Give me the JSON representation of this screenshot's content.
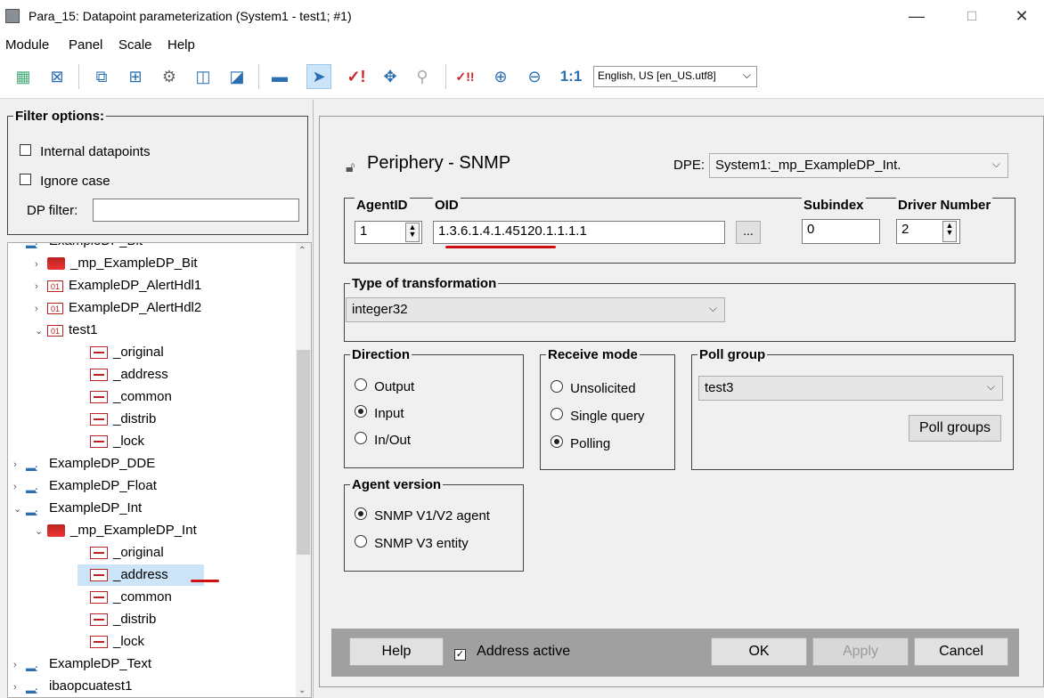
{
  "window": {
    "title": "Para_15: Datapoint parameterization (System1 - test1; #1)",
    "controls": {
      "minimize": "—",
      "maximize": "☐",
      "close": "✕"
    }
  },
  "menu": [
    "Module",
    "Panel",
    "Scale",
    "Help"
  ],
  "toolbar": {
    "zoom_reset": "1:1",
    "language": "English, US [en_US.utf8]"
  },
  "filter": {
    "legend": "Filter options:",
    "internal_datapoints": "Internal datapoints",
    "ignore_case": "Ignore case",
    "dp_filter_label": "DP filter:",
    "dp_filter_value": ""
  },
  "tree": {
    "items": [
      {
        "label": "ExampleDP_Bit",
        "indent": 0,
        "twisty": "",
        "icon": "dp"
      },
      {
        "label": "_mp_ExampleDP_Bit",
        "indent": 1,
        "twisty": "›",
        "icon": "mp"
      },
      {
        "label": "ExampleDP_AlertHdl1",
        "indent": 1,
        "twisty": "›",
        "icon": "01"
      },
      {
        "label": "ExampleDP_AlertHdl2",
        "indent": 1,
        "twisty": "›",
        "icon": "01"
      },
      {
        "label": "test1",
        "indent": 1,
        "twisty": "⌄",
        "icon": "01"
      },
      {
        "label": "_original",
        "indent": 2,
        "twisty": "",
        "icon": "cfg"
      },
      {
        "label": "_address",
        "indent": 2,
        "twisty": "",
        "icon": "cfg"
      },
      {
        "label": "_common",
        "indent": 2,
        "twisty": "",
        "icon": "cfg"
      },
      {
        "label": "_distrib",
        "indent": 2,
        "twisty": "",
        "icon": "cfg"
      },
      {
        "label": "_lock",
        "indent": 2,
        "twisty": "",
        "icon": "cfg"
      },
      {
        "label": "ExampleDP_DDE",
        "indent": 0,
        "twisty": "›",
        "icon": "dp"
      },
      {
        "label": "ExampleDP_Float",
        "indent": 0,
        "twisty": "›",
        "icon": "dp"
      },
      {
        "label": "ExampleDP_Int",
        "indent": 0,
        "twisty": "⌄",
        "icon": "dp"
      },
      {
        "label": "_mp_ExampleDP_Int",
        "indent": 1,
        "twisty": "⌄",
        "icon": "mp"
      },
      {
        "label": "_original",
        "indent": 2,
        "twisty": "",
        "icon": "cfg"
      },
      {
        "label": "_address",
        "indent": 2,
        "twisty": "",
        "icon": "cfg",
        "selected": true
      },
      {
        "label": "_common",
        "indent": 2,
        "twisty": "",
        "icon": "cfg"
      },
      {
        "label": "_distrib",
        "indent": 2,
        "twisty": "",
        "icon": "cfg"
      },
      {
        "label": "_lock",
        "indent": 2,
        "twisty": "",
        "icon": "cfg"
      },
      {
        "label": "ExampleDP_Text",
        "indent": 0,
        "twisty": "›",
        "icon": "dp"
      },
      {
        "label": "ibaopcuatest1",
        "indent": 0,
        "twisty": "›",
        "icon": "dp"
      }
    ]
  },
  "periphery": {
    "heading": "Periphery - SNMP",
    "dpe_label": "DPE:",
    "dpe_value": "System1:_mp_ExampleDP_Int."
  },
  "address": {
    "agentid_label": "AgentID",
    "agentid_value": "1",
    "oid_label": "OID",
    "oid_value": "1.3.6.1.4.1.45120.1.1.1.1",
    "browse_label": "...",
    "subindex_label": "Subindex",
    "subindex_value": "0",
    "driver_label": "Driver Number",
    "driver_value": "2"
  },
  "transformation": {
    "legend": "Type of transformation",
    "value": "integer32"
  },
  "direction": {
    "legend": "Direction",
    "options": [
      "Output",
      "Input",
      "In/Out"
    ],
    "selected": "Input"
  },
  "receive_mode": {
    "legend": "Receive mode",
    "options": [
      "Unsolicited",
      "Single query",
      "Polling"
    ],
    "selected": "Polling"
  },
  "poll_group": {
    "legend": "Poll group",
    "value": "test3",
    "button": "Poll groups"
  },
  "agent_version": {
    "legend": "Agent version",
    "options": [
      "SNMP V1/V2 agent",
      "SNMP V3 entity"
    ],
    "selected": "SNMP V1/V2 agent"
  },
  "footer": {
    "help": "Help",
    "address_active": "Address active",
    "address_active_checked": true,
    "ok": "OK",
    "apply": "Apply",
    "cancel": "Cancel"
  },
  "colors": {
    "annotation_red": "#d01010",
    "selection": "#cce4f7"
  }
}
